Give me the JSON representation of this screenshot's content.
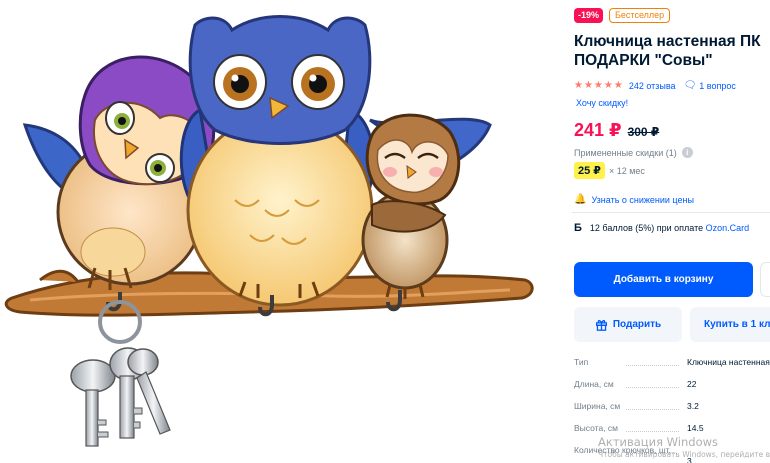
{
  "product": {
    "discount_badge": "-19%",
    "bestseller_badge": "Бестселлер",
    "title": "Ключница настенная ПК ПОДАРКИ \"Совы\"",
    "rating_stars": "★★★★★",
    "reviews": "242 отзыва",
    "questions": "1 вопрос",
    "want_discount": "Хочу скидку!",
    "price": "241 ₽",
    "old_price": "300 ₽",
    "applied_discounts": "Примененные скидки (1)",
    "installment_price": "25 ₽",
    "installment_term": "× 12 мес",
    "notify_price_drop": "Узнать о снижении цены",
    "bonus_icon": "Б",
    "bonus_text": "12 баллов (5%) при оплате",
    "bonus_card": "Ozon.Card",
    "add_to_cart": "Добавить в корзину",
    "gift": "Подарить",
    "buy_one_click": "Купить в 1 кли"
  },
  "specs": [
    {
      "label": "Тип",
      "value": "Ключница настенная"
    },
    {
      "label": "Длина, см",
      "value": "22"
    },
    {
      "label": "Ширина, см",
      "value": "3.2"
    },
    {
      "label": "Высота, см",
      "value": "14.5"
    },
    {
      "label": "Количество крючков, шт.",
      "value": "3"
    }
  ],
  "watermark": {
    "title": "Активация Windows",
    "subtitle": "Чтобы активировать Windows, перейдите в"
  },
  "colors": {
    "accent": "#005bff",
    "price": "#f91155",
    "badge_orange": "#f1800a",
    "installment_bg": "#fff04a"
  },
  "icons": {
    "questions": "speech-bubble-icon",
    "info": "info-icon",
    "bell": "bell-icon",
    "gift": "gift-icon"
  }
}
